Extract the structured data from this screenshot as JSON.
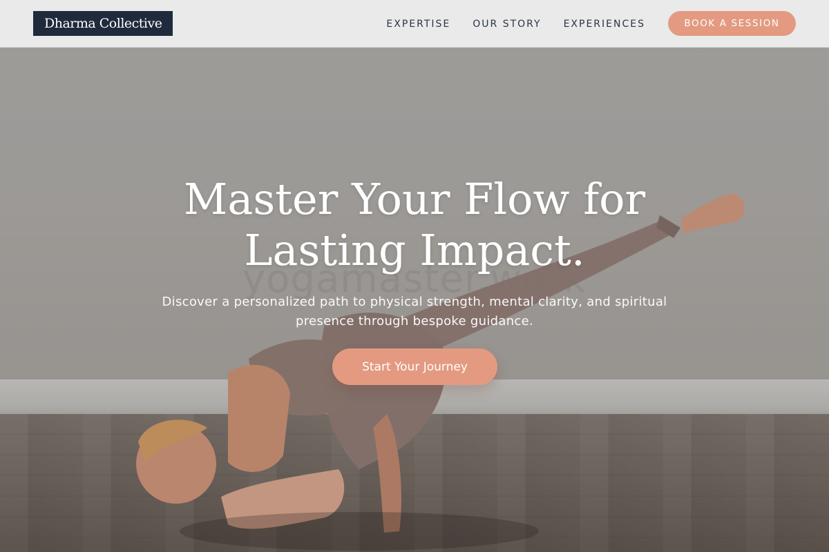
{
  "nav": {
    "logo": "Dharma Collective",
    "links": [
      "EXPERTISE",
      "OUR STORY",
      "EXPERIENCES"
    ],
    "book_button": "BOOK A SESSION"
  },
  "hero": {
    "headline_line1": "Master Your Flow for",
    "headline_line2": "Lasting Impact.",
    "subtext": "Discover a personalized path to physical strength, mental clarity, and spiritual presence through bespoke guidance.",
    "cta": "Start Your Journey",
    "watermark": "yogamaster.work"
  },
  "colors": {
    "accent": "#e39a80",
    "logo_bg": "#1f2a3c",
    "nav_text": "#2a3344"
  }
}
